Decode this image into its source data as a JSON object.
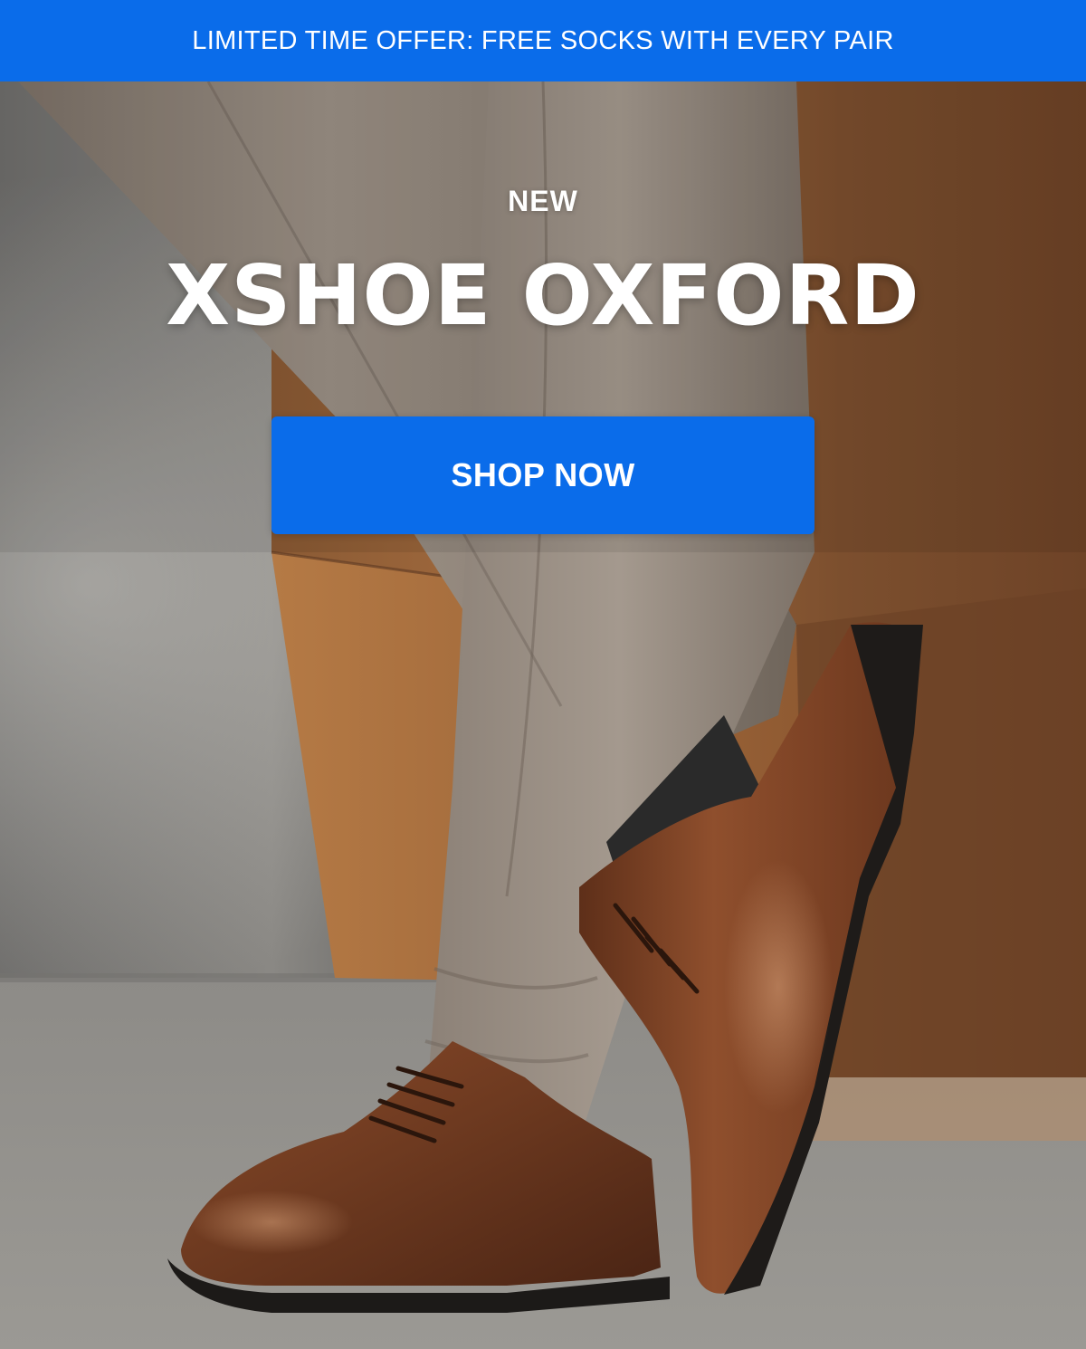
{
  "promo_bar": {
    "text": "LIMITED TIME OFFER: FREE SOCKS WITH EVERY PAIR",
    "color": "#0a6cea"
  },
  "hero": {
    "eyebrow": "NEW",
    "headline": "XSHOE OXFORD",
    "cta_label": "SHOP NOW",
    "cta_color": "#0a6cea"
  }
}
